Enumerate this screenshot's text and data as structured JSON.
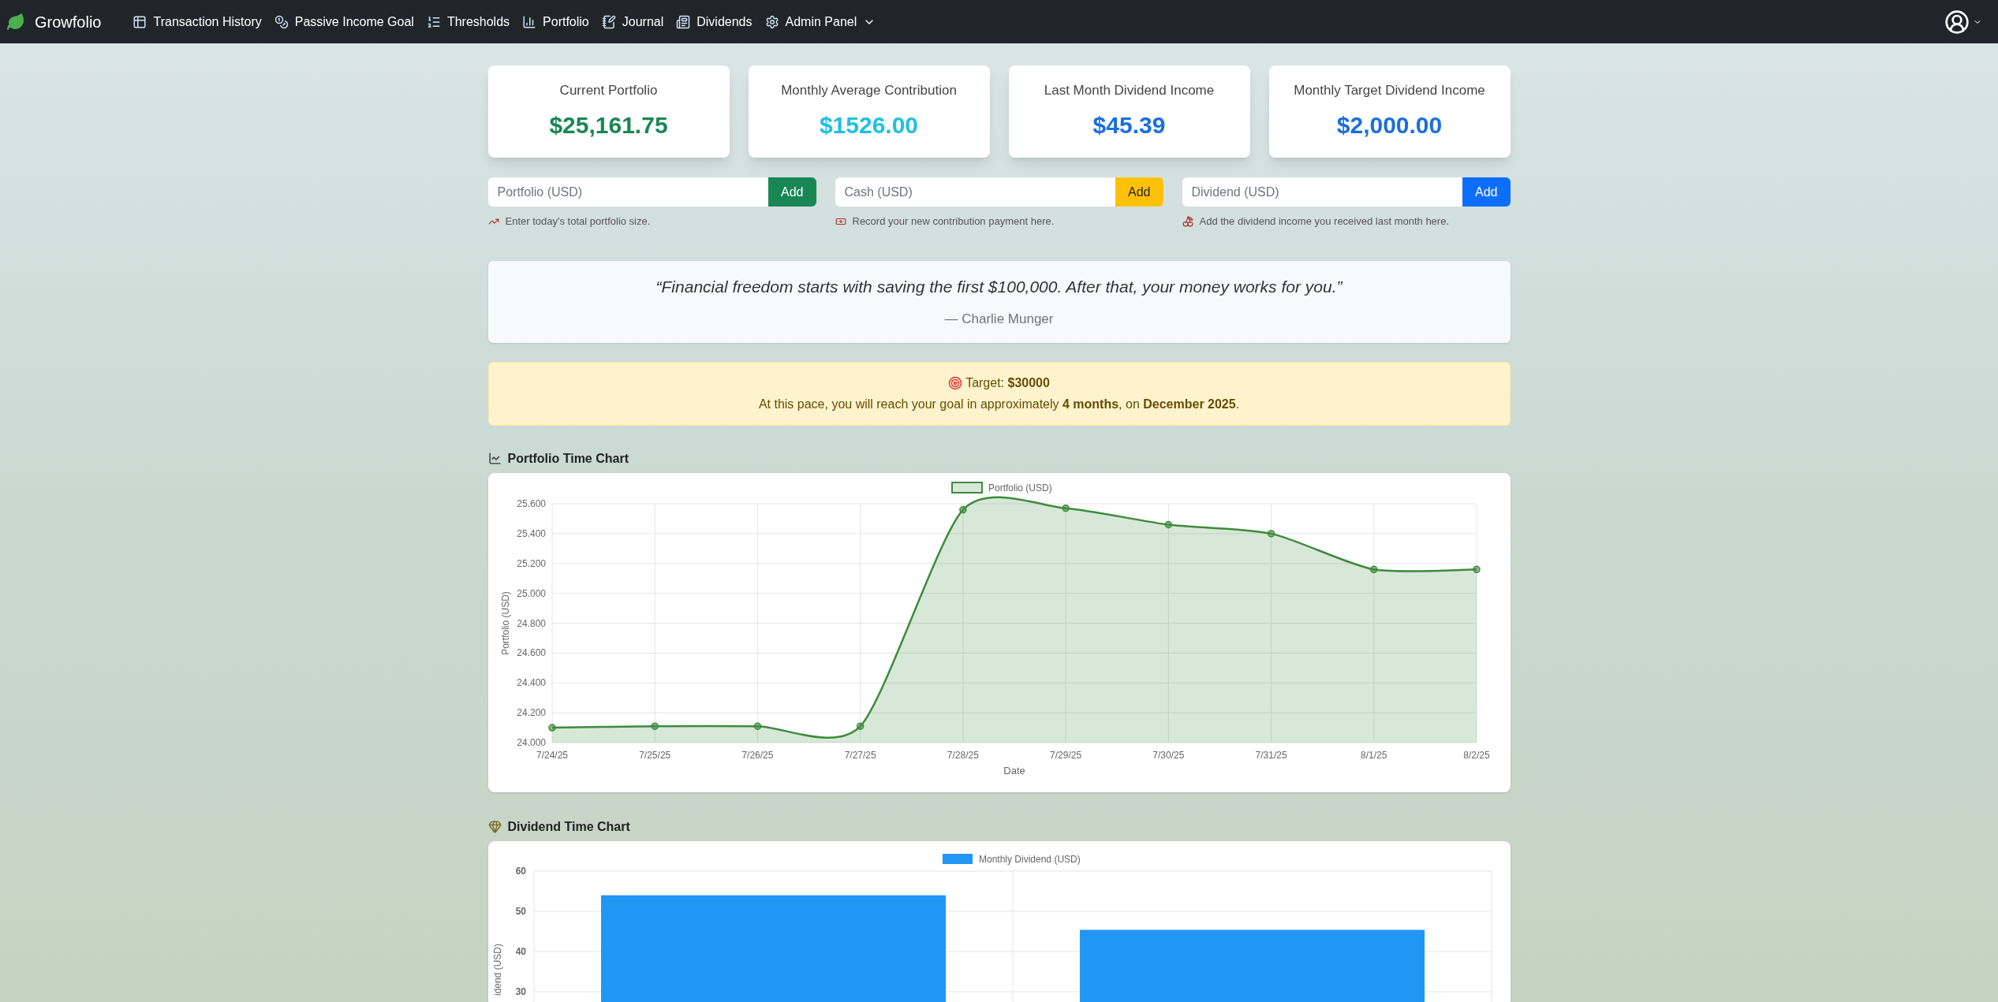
{
  "navbar": {
    "brand": "Growfolio",
    "items": [
      {
        "label": "Transaction History",
        "kind": "link"
      },
      {
        "label": "Passive Income Goal",
        "kind": "link"
      },
      {
        "label": "Thresholds",
        "kind": "link"
      },
      {
        "label": "Portfolio",
        "kind": "link"
      },
      {
        "label": "Journal",
        "kind": "link"
      },
      {
        "label": "Dividends",
        "kind": "link"
      },
      {
        "label": "Admin Panel",
        "kind": "dropdown"
      }
    ]
  },
  "stats": [
    {
      "title": "Current Portfolio",
      "value": "$25,161.75",
      "color": "#198754"
    },
    {
      "title": "Monthly Average Contribution",
      "value": "$1526.00",
      "color": "#1fc1e0"
    },
    {
      "title": "Last Month Dividend Income",
      "value": "$45.39",
      "color": "#1a6fdf"
    },
    {
      "title": "Monthly Target Dividend Income",
      "value": "$2,000.00",
      "color": "#1a6fdf"
    }
  ],
  "entries": [
    {
      "placeholder": "Portfolio (USD)",
      "button": "Add",
      "kind": "success",
      "help": "Enter today's total portfolio size."
    },
    {
      "placeholder": "Cash (USD)",
      "button": "Add",
      "kind": "warning",
      "help": "Record your new contribution payment here."
    },
    {
      "placeholder": "Dividend (USD)",
      "button": "Add",
      "kind": "primary",
      "help": "Add the dividend income you received last month here."
    }
  ],
  "quote": {
    "text": "“Financial freedom starts with saving the first $100,000. After that, your money works for you.”",
    "author": "— Charlie Munger"
  },
  "target": {
    "line_1": "Target: **$30000**",
    "line_2": "At this pace, you will reach your goal in approximately **4 months**, on **December 2025**."
  },
  "portfolio_chart": {
    "title": "Portfolio Time Chart",
    "chart_data": {
      "type": "area",
      "xlabel": "Date",
      "ylabel": "Portfolio (USD)",
      "categories": [
        "7/24/25",
        "7/25/25",
        "7/26/25",
        "7/27/25",
        "7/28/25",
        "7/29/25",
        "7/30/25",
        "7/31/25",
        "8/1/25",
        "8/2/25"
      ],
      "series": [
        {
          "name": "Portfolio (USD)",
          "color": "#3d8b3d",
          "values": [
            24.1,
            24.11,
            24.11,
            24.11,
            25.56,
            25.57,
            25.46,
            25.4,
            25.16,
            25.16
          ]
        }
      ],
      "ylim": [
        24,
        25.6
      ],
      "grid": true,
      "yticks": [
        {
          "value": 24,
          "label": "24.000"
        },
        {
          "value": 24.2,
          "label": "24.200"
        },
        {
          "value": 24.4,
          "label": "24.400"
        },
        {
          "value": 24.6,
          "label": "24.600"
        },
        {
          "value": 24.8,
          "label": "24.800"
        },
        {
          "value": 25,
          "label": "25.000"
        },
        {
          "value": 25.2,
          "label": "25.200"
        },
        {
          "value": 25.4,
          "label": "25.400"
        },
        {
          "value": 25.6,
          "label": "25.600"
        }
      ]
    }
  },
  "dividend_chart": {
    "title": "Dividend Time Chart",
    "chart_data": {
      "type": "bar",
      "ylabel": "idend (USD)",
      "series": [
        {
          "name": "Monthly Dividend (USD)",
          "color": "#2196f3",
          "values": [
            54,
            45.4
          ]
        }
      ],
      "ylim": [
        0,
        60
      ],
      "grid": true,
      "yticks": [
        60,
        50,
        40,
        30
      ]
    }
  }
}
